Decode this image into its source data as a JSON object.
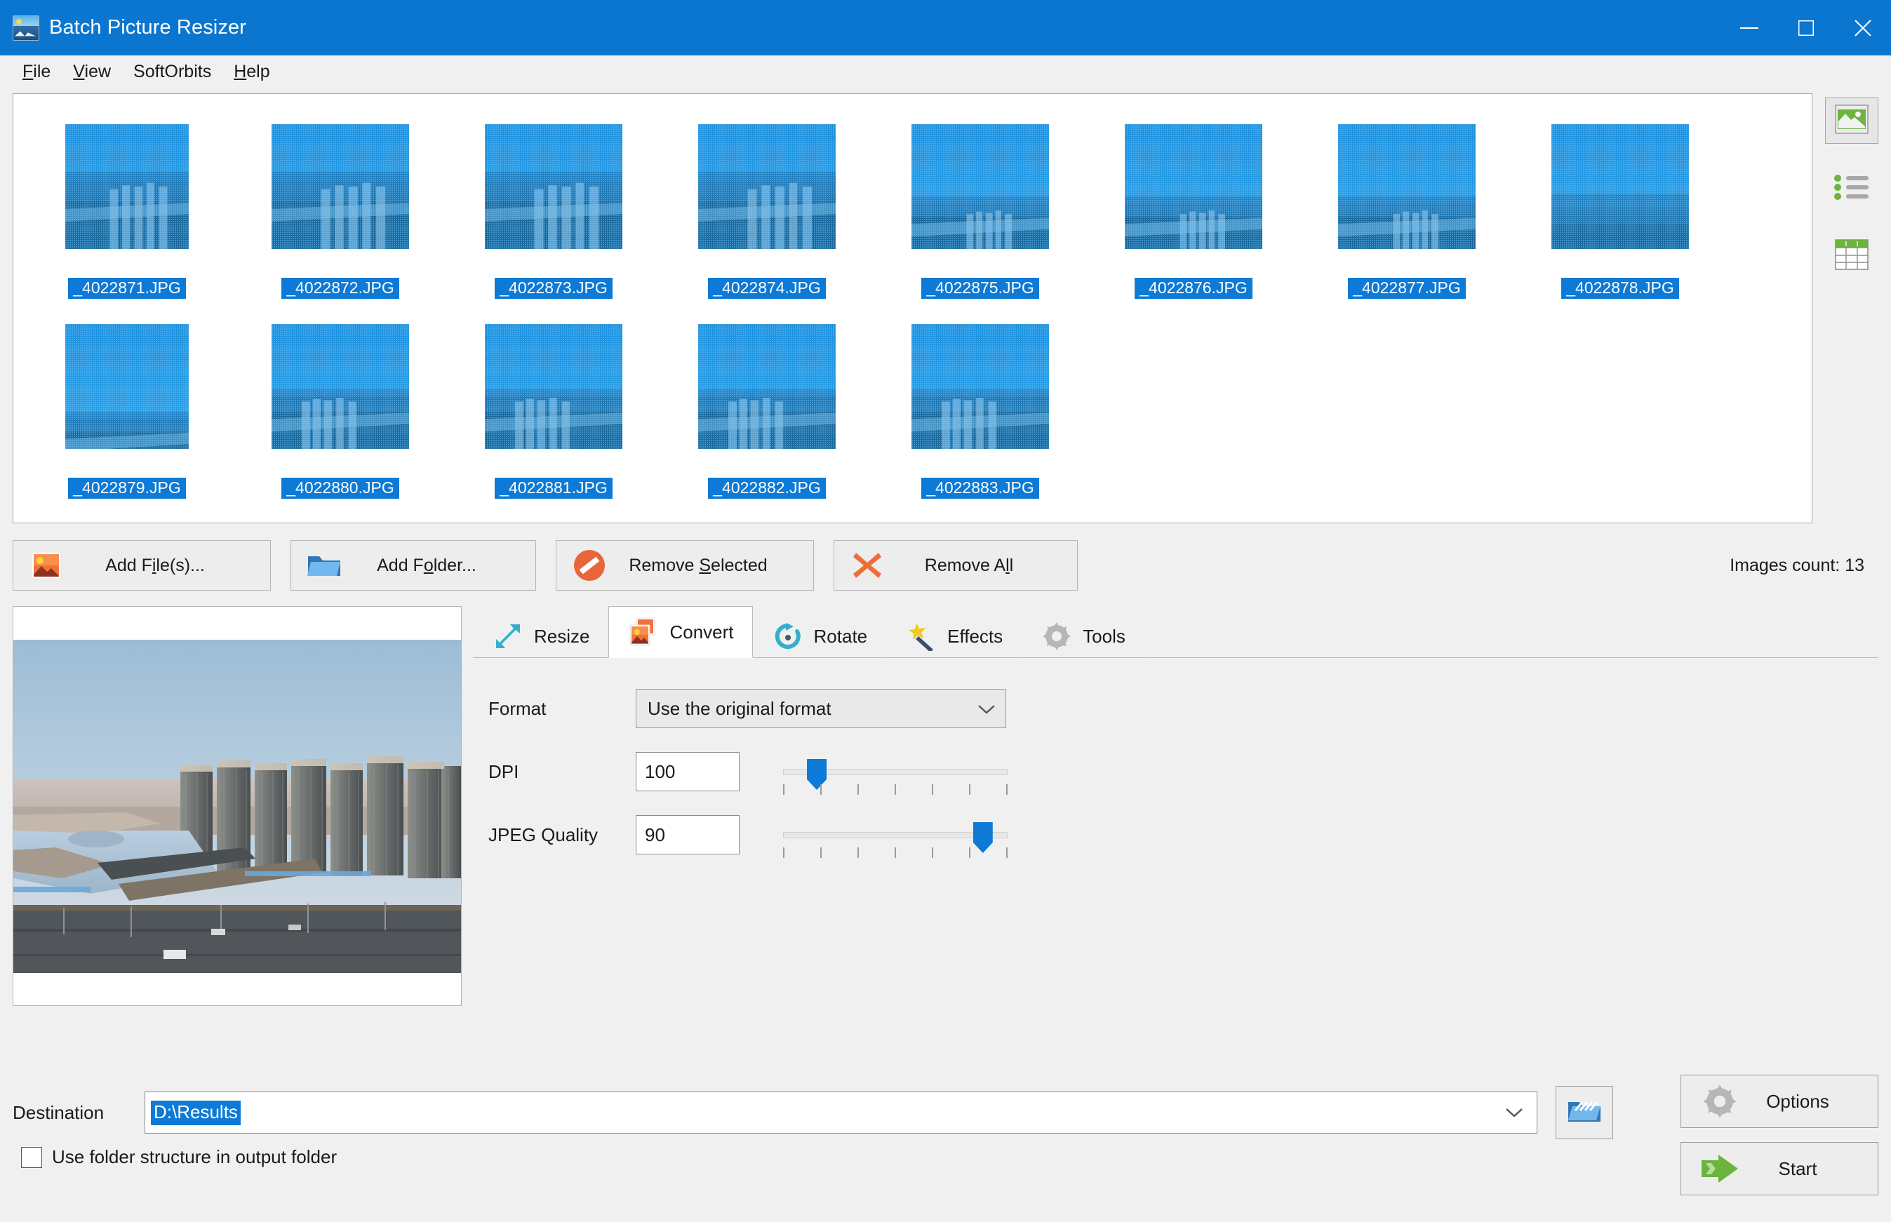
{
  "window": {
    "title": "Batch Picture Resizer",
    "app_icon": "picture-icon",
    "minimize_label": "Minimize",
    "maximize_label": "Maximize",
    "close_label": "Close"
  },
  "menu": {
    "items": [
      {
        "label": "File",
        "accel": "F"
      },
      {
        "label": "View",
        "accel": "V"
      },
      {
        "label": "SoftOrbits",
        "accel": ""
      },
      {
        "label": "Help",
        "accel": "H"
      }
    ]
  },
  "thumbnails": {
    "selected_all": true,
    "items": [
      {
        "label": "_4022871.JPG",
        "selected": true,
        "variant": "a"
      },
      {
        "label": "_4022872.JPG",
        "selected": true,
        "variant": "a"
      },
      {
        "label": "_4022873.JPG",
        "selected": true,
        "variant": "a"
      },
      {
        "label": "_4022874.JPG",
        "selected": true,
        "variant": "a"
      },
      {
        "label": "_4022875.JPG",
        "selected": true,
        "variant": "b"
      },
      {
        "label": "_4022876.JPG",
        "selected": true,
        "variant": "b"
      },
      {
        "label": "_4022877.JPG",
        "selected": true,
        "variant": "b"
      },
      {
        "label": "_4022878.JPG",
        "selected": true,
        "variant": "c"
      },
      {
        "label": "_4022879.JPG",
        "selected": true,
        "variant": "d"
      },
      {
        "label": "_4022880.JPG",
        "selected": true,
        "variant": "e"
      },
      {
        "label": "_4022881.JPG",
        "selected": true,
        "variant": "e"
      },
      {
        "label": "_4022882.JPG",
        "selected": true,
        "variant": "e"
      },
      {
        "label": "_4022883.JPG",
        "selected": true,
        "variant": "e"
      }
    ]
  },
  "view_modes": [
    {
      "name": "thumbnail-view",
      "icon": "image-icon",
      "active": true
    },
    {
      "name": "list-view",
      "icon": "list-icon",
      "active": false
    },
    {
      "name": "details-view",
      "icon": "table-icon",
      "active": false
    }
  ],
  "toolbar": {
    "add_files": {
      "label_pre": "Add F",
      "accel": "i",
      "label_post": "le(s)...",
      "icon": "image-add-icon"
    },
    "add_folder": {
      "label_pre": "Add F",
      "accel": "o",
      "label_post": "lder...",
      "icon": "folder-icon"
    },
    "remove_selected": {
      "label_pre": "Remove ",
      "accel": "S",
      "label_post": "elected",
      "icon": "no-entry-icon"
    },
    "remove_all": {
      "label_pre": "Remove A",
      "accel": "l",
      "label_post": "l",
      "icon": "red-x-icon"
    },
    "images_count": "Images count: 13"
  },
  "tabs": [
    {
      "label": "Resize",
      "icon": "resize-arrow-icon",
      "active": false
    },
    {
      "label": "Convert",
      "icon": "convert-image-icon",
      "active": true
    },
    {
      "label": "Rotate",
      "icon": "rotate-icon",
      "active": false
    },
    {
      "label": "Effects",
      "icon": "magic-wand-icon",
      "active": false
    },
    {
      "label": "Tools",
      "icon": "gear-icon",
      "active": false
    }
  ],
  "convert_panel": {
    "format_label": "Format",
    "format_value": "Use the original format",
    "format_options": [
      "Use the original format"
    ],
    "dpi_label": "DPI",
    "dpi_value": "100",
    "dpi_slider_percent": 15,
    "jpeg_quality_label": "JPEG Quality",
    "jpeg_quality_value": "90",
    "jpeg_quality_slider_percent": 89,
    "slider_tick_count": 7
  },
  "destination": {
    "label": "Destination",
    "value": "D:\\Results",
    "value_selected": true,
    "browse_icon": "open-folder-icon",
    "dropdown_icon": "chevron-down-icon"
  },
  "folder_structure_checkbox": {
    "label": "Use folder structure in output folder",
    "checked": false
  },
  "actions": {
    "options": {
      "label": "Options",
      "icon": "gear-icon"
    },
    "start": {
      "label": "Start",
      "icon": "green-arrow-icon"
    }
  },
  "colors": {
    "titlebar": "#0b76d0",
    "selection": "#0c7ad6",
    "window_bg": "#f0f0f0",
    "accent_green": "#6cb33f",
    "accent_orange": "#e8663a",
    "accent_cyan": "#35aecd"
  }
}
